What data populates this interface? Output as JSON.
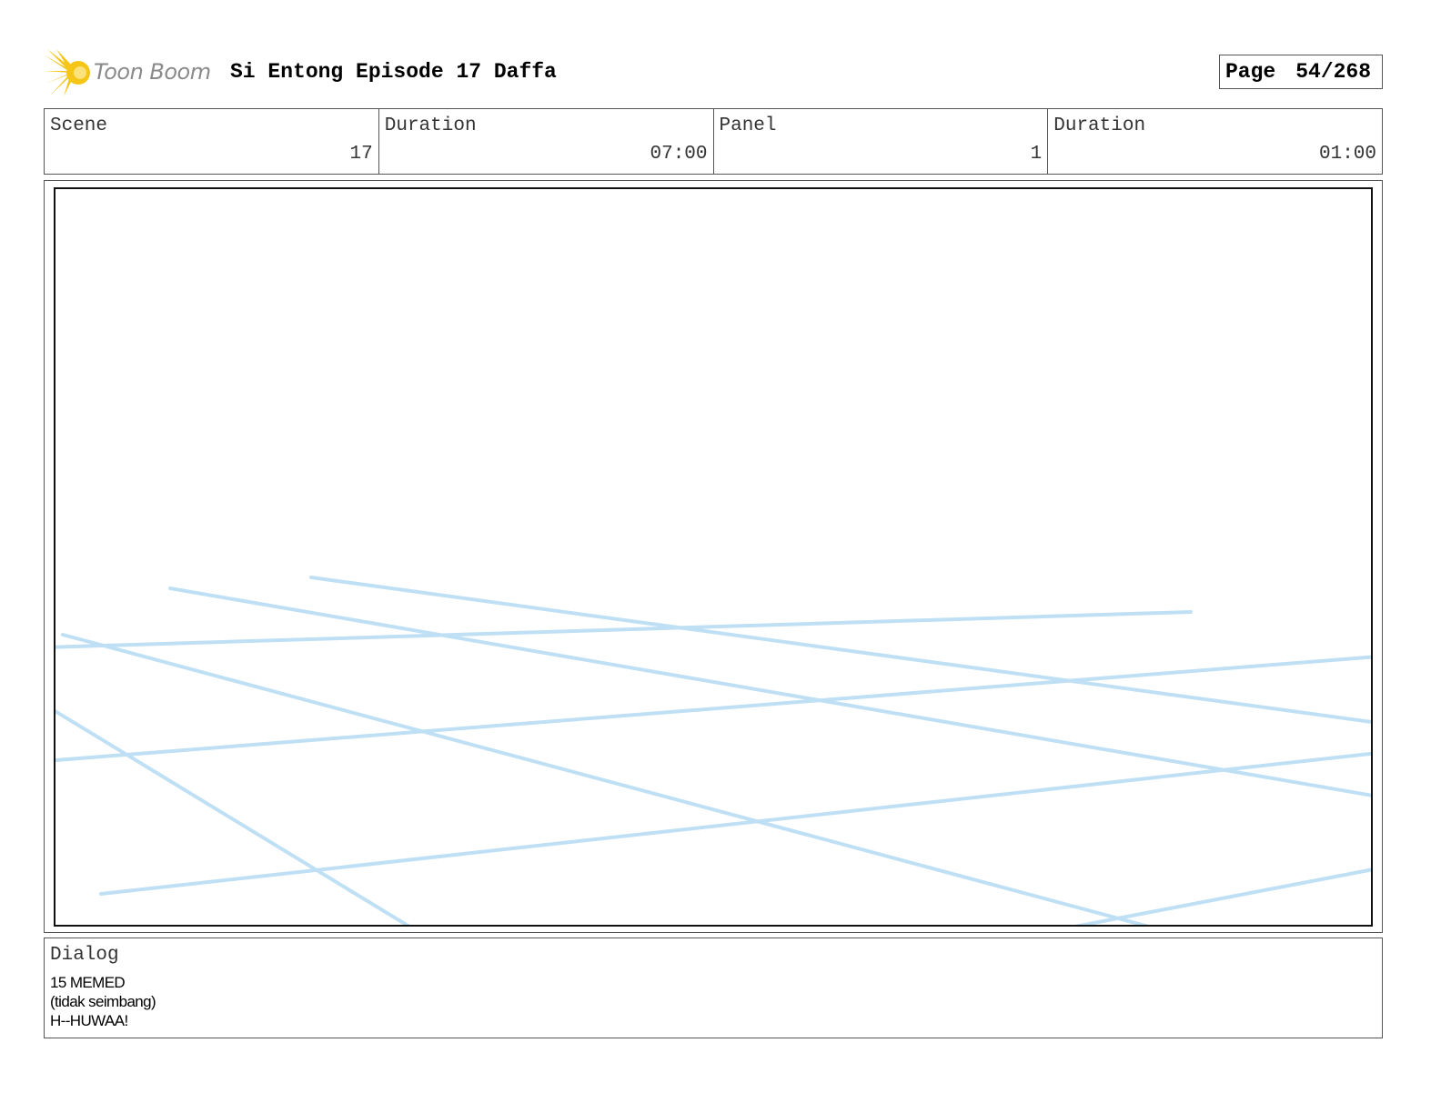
{
  "header": {
    "logo_text": "Toon Boom",
    "title": "Si Entong Episode 17 Daffa",
    "page_label": "Page",
    "page_value": "54/268"
  },
  "info": [
    {
      "label": "Scene",
      "value": "17"
    },
    {
      "label": "Duration",
      "value": "07:00"
    },
    {
      "label": "Panel",
      "value": "1"
    },
    {
      "label": "Duration",
      "value": "01:00"
    }
  ],
  "panel": {
    "sketch_color": "#bfe0f4"
  },
  "dialog": {
    "label": "Dialog",
    "lines": [
      "15 MEMED",
      "(tidak seimbang)",
      "H--HUWAA!"
    ]
  },
  "colors": {
    "logo_star": "#f5c518",
    "logo_text": "#8a8a8a",
    "border": "#555555"
  }
}
